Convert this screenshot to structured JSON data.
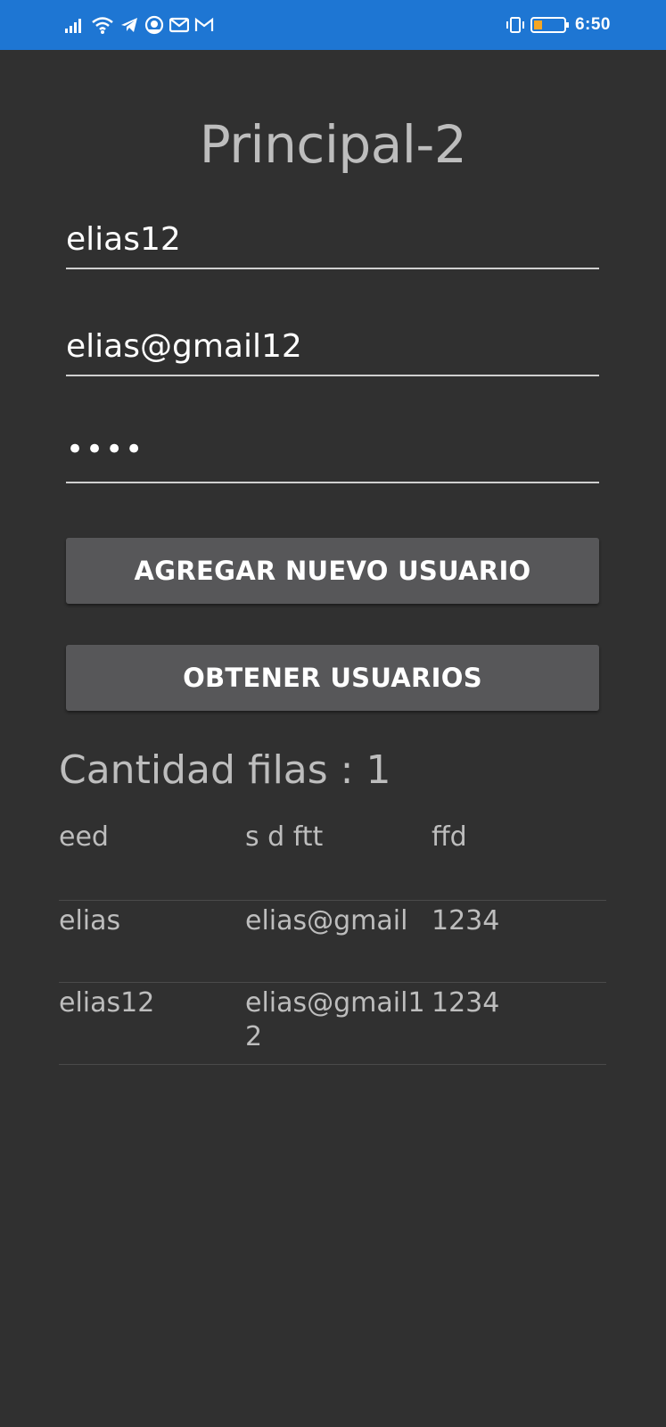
{
  "status_bar": {
    "time": "6:50",
    "battery": "24",
    "background": "#1e76d3",
    "icons_left": [
      "signal-icon",
      "wifi-icon",
      "telegram-icon",
      "app-icon",
      "mail-icon",
      "gmail-icon"
    ],
    "icons_right": [
      "vibrate-icon",
      "battery-icon"
    ]
  },
  "page": {
    "title": "Principal-2",
    "background": "#303030"
  },
  "form": {
    "username_value": "elias12",
    "email_value": "elias@gmail12",
    "password_value": "••••"
  },
  "buttons": {
    "add_user": "AGREGAR NUEVO USUARIO",
    "get_users": "OBTENER USUARIOS"
  },
  "summary": {
    "rows_count_text": "Cantidad filas : 1"
  },
  "table": {
    "headers": [
      "eed",
      "s d ftt",
      "ffd"
    ],
    "rows": [
      [
        "elias",
        "elias@gmail",
        "1234"
      ],
      [
        "elias12",
        "elias@gmail12",
        "1234"
      ]
    ]
  }
}
